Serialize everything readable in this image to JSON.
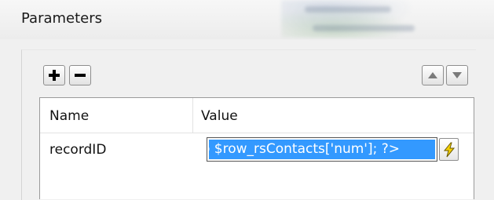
{
  "dialog": {
    "title": "Parameters"
  },
  "toolbar": {
    "add_icon": "plus-icon",
    "remove_icon": "minus-icon",
    "move_up_icon": "triangle-up-icon",
    "move_down_icon": "triangle-down-icon"
  },
  "grid": {
    "columns": [
      "Name",
      "Value"
    ],
    "rows": [
      {
        "name": "recordID",
        "value": "o $row_rsContacts['num']; ?>",
        "value_selected": true
      }
    ],
    "dynamic_data_icon": "lightning-bolt-icon"
  },
  "colors": {
    "selection": "#3399ff",
    "bolt": "#f5d000"
  }
}
